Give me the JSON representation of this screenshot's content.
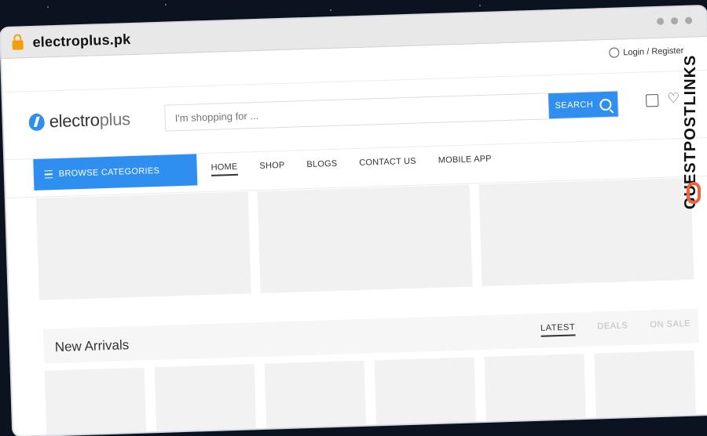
{
  "browser": {
    "url": "electroplus.pk"
  },
  "topbar": {
    "login_label": "Login / Register"
  },
  "header": {
    "logo_text_main": "electro",
    "logo_text_accent": "plus",
    "search_placeholder": "I'm shopping for ...",
    "search_button_label": "SEARCH"
  },
  "nav": {
    "browse_label": "BROWSE CATEGORIES",
    "links": [
      "HOME",
      "SHOP",
      "BLOGS",
      "CONTACT US",
      "MOBILE APP"
    ]
  },
  "section": {
    "title": "New Arrivals",
    "tabs": [
      "LATEST",
      "DEALS",
      "ON SALE"
    ]
  },
  "watermark": {
    "text": "GUESTPOSTLINKS"
  },
  "colors": {
    "accent": "#2f8ff0",
    "lock": "#f59e0b",
    "watermark_logo": "#f0623a"
  }
}
